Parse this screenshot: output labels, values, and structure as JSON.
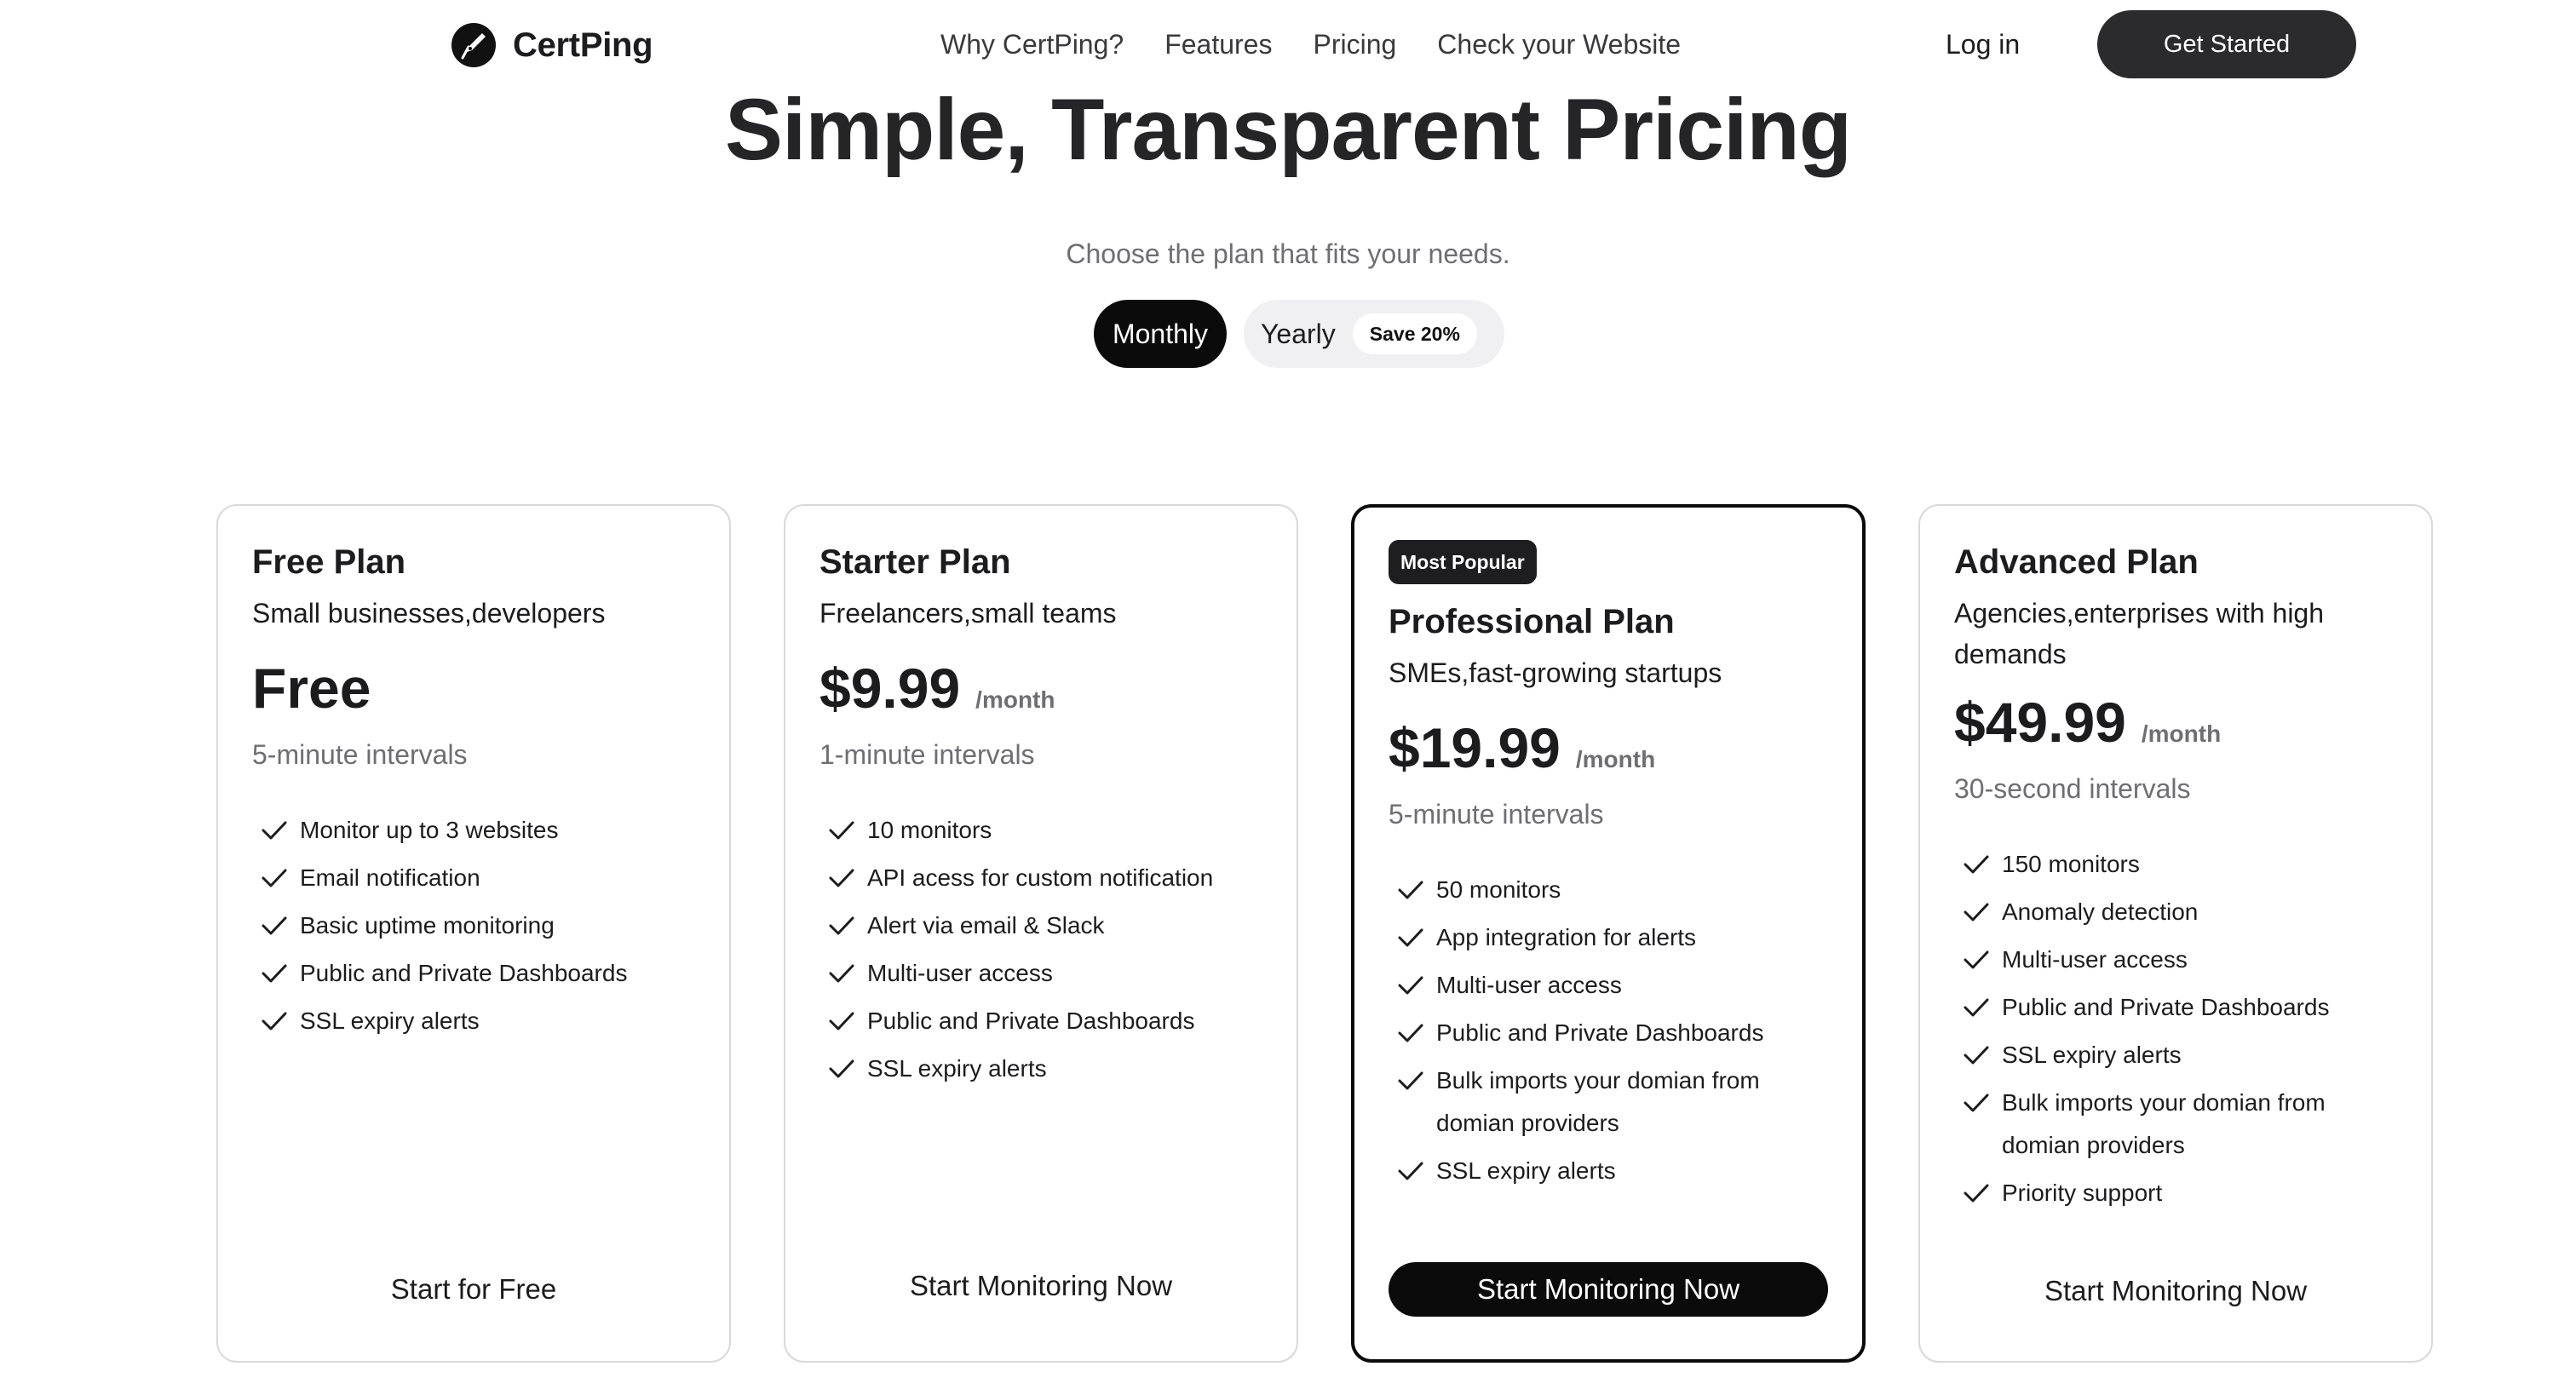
{
  "brand": {
    "name": "CertPing",
    "logo_icon": "pen-nib-icon"
  },
  "nav": {
    "links": [
      "Why CertPing?",
      "Features",
      "Pricing",
      "Check your Website"
    ],
    "login": "Log in",
    "cta": "Get Started"
  },
  "hero": {
    "title": "Simple, Transparent Pricing",
    "subtitle": "Choose the plan that fits your needs."
  },
  "billing_toggle": {
    "monthly": "Monthly",
    "yearly": "Yearly",
    "yearly_badge": "Save 20%",
    "selected": "Monthly"
  },
  "plans": [
    {
      "name": "Free Plan",
      "description": "Small businesses,developers",
      "price": "Free",
      "period": "",
      "interval": "5-minute intervals",
      "features": [
        "Monitor up to 3 websites",
        "Email notification",
        "Basic uptime monitoring",
        "Public and Private Dashboards",
        "SSL expiry alerts"
      ],
      "cta": "Start for Free"
    },
    {
      "name": "Starter Plan",
      "description": "Freelancers,small teams",
      "price": "$9.99",
      "period": "/month",
      "interval": "1-minute intervals",
      "features": [
        "10 monitors",
        "API acess for custom notification",
        "Alert via email & Slack",
        "Multi-user access",
        "Public and Private Dashboards",
        "SSL expiry alerts"
      ],
      "cta": "Start Monitoring Now"
    },
    {
      "badge": "Most Popular",
      "name": "Professional Plan",
      "description": "SMEs,fast-growing startups",
      "price": "$19.99",
      "period": "/month",
      "interval": "5-minute intervals",
      "features": [
        "50 monitors",
        "App integration for alerts",
        "Multi-user access",
        "Public and Private Dashboards",
        "Bulk imports your domian from domian providers",
        "SSL expiry alerts"
      ],
      "cta": "Start Monitoring Now"
    },
    {
      "name": "Advanced Plan",
      "description": "Agencies,enterprises with high demands",
      "price": "$49.99",
      "period": "/month",
      "interval": "30-second intervals",
      "features": [
        "150 monitors",
        "Anomaly detection",
        "Multi-user access",
        "Public and Private Dashboards",
        "SSL expiry alerts",
        "Bulk imports your domian from domian providers",
        "Priority support"
      ],
      "cta": "Start Monitoring Now"
    }
  ],
  "colors": {
    "primary": "#0b0b0c",
    "text": "#1c1c1e",
    "muted": "#6e6e73",
    "border": "#d9d9dc",
    "toggle_bg": "#f0f0f2"
  }
}
